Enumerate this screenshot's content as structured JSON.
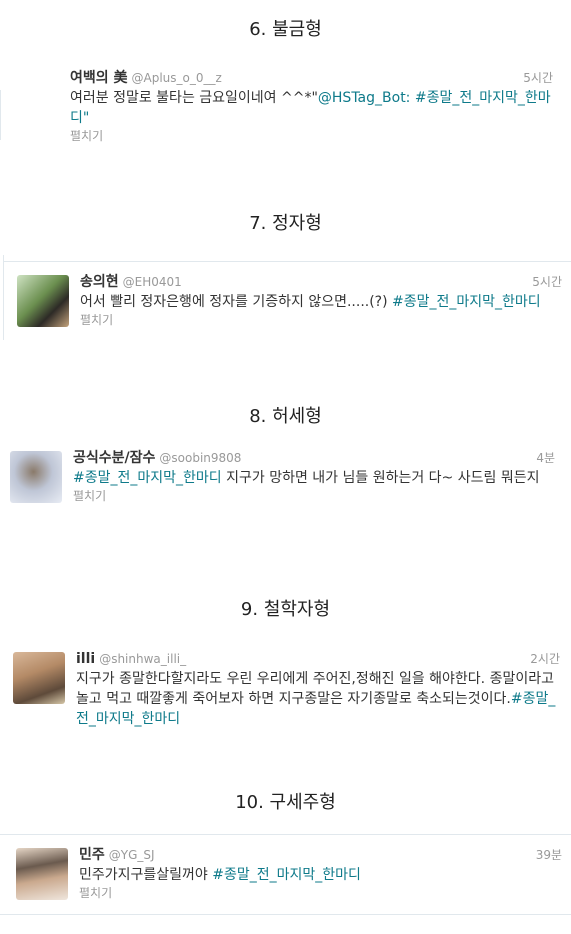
{
  "sections": [
    {
      "heading": "6. 불금형",
      "tweet": {
        "name": "여백의 美",
        "handle": "@Aplus_o_0__z",
        "time": "5시간",
        "text": "여러분 정말로 불타는 금요일이네여 ^^*\"",
        "tag": "@HSTag_Bot: #종말_전_마지막_한마디\"",
        "expand": "펼치기"
      }
    },
    {
      "heading": "7. 정자형",
      "tweet": {
        "name": "송의현",
        "handle": "@EH0401",
        "time": "5시간",
        "text": "어서 빨리 정자은행에 정자를 기증하지 않으면.....(?) ",
        "tag": "#종말_전_마지막_한마디",
        "expand": "펼치기"
      }
    },
    {
      "heading": "8. 허세형",
      "tweet": {
        "name": "공식수분/잠수",
        "handle": "@soobin9808",
        "time": "4분",
        "tag": "#종말_전_마지막_한마디",
        "text": " 지구가 망하면 내가 님들 원하는거 다~ 사드림 뭐든지",
        "expand": "펼치기"
      }
    },
    {
      "heading": "9. 철학자형",
      "tweet": {
        "name": "illi",
        "handle": "@shinhwa_illi_",
        "time": "2시간",
        "text": "지구가 종말한다할지라도 우린 우리에게 주어진,정해진 일을 해야한다. 종말이라고 놀고 먹고 때깔좋게 죽어보자 하면 지구종말은 자기종말로 축소되는것이다.",
        "tag": "#종말_전_마지막_한마디"
      }
    },
    {
      "heading": "10. 구세주형",
      "tweet": {
        "name": "민주",
        "handle": "@YG_SJ",
        "time": "39분",
        "text": "민주가지구를살릴꺼야 ",
        "tag": "#종말_전_마지막_한마디",
        "expand": "펼치기"
      }
    }
  ],
  "colors": {
    "hashtag": "#0e7a8a",
    "meta": "#999999",
    "divider": "#e1e8ed"
  }
}
